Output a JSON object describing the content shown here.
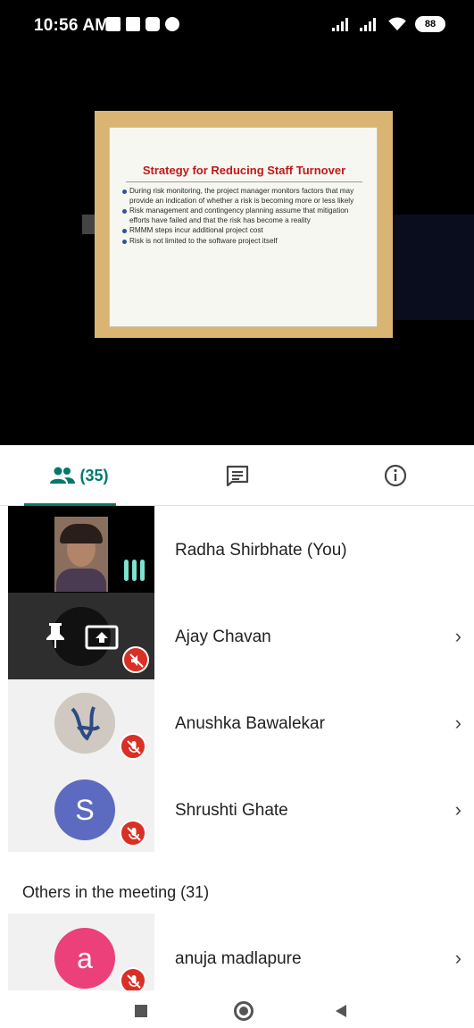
{
  "status_bar": {
    "time": "10:56 AM",
    "battery": "88"
  },
  "presentation": {
    "title": "Strategy for Reducing Staff Turnover",
    "bullets": [
      "During risk monitoring, the project manager monitors factors that may provide an indication of whether a risk is becoming more or less likely",
      "Risk management and contingency planning assume that mitigation efforts have failed and that the risk has become a reality",
      "RMMM steps incur additional project cost",
      "Risk is not limited to the software project itself"
    ]
  },
  "tabs": {
    "people_count": "(35)",
    "people_icon": "people-icon",
    "chat_icon": "chat-icon",
    "info_icon": "info-icon"
  },
  "participants": [
    {
      "name": "Radha Shirbhate (You)"
    },
    {
      "name": "Ajay Chavan"
    },
    {
      "name": "Anushka Bawalekar"
    },
    {
      "name": "Shrushti Ghate",
      "initial": "S"
    }
  ],
  "others": {
    "label": "Others in the meeting (31)",
    "items": [
      {
        "name": "anuja madlapure",
        "initial": "a"
      }
    ]
  },
  "colors": {
    "accent": "#00796b",
    "mute_red": "#d93025",
    "avatar_s": "#5c6bc0",
    "avatar_a": "#ec407a",
    "speaking_bars": "#7ee2cf"
  }
}
